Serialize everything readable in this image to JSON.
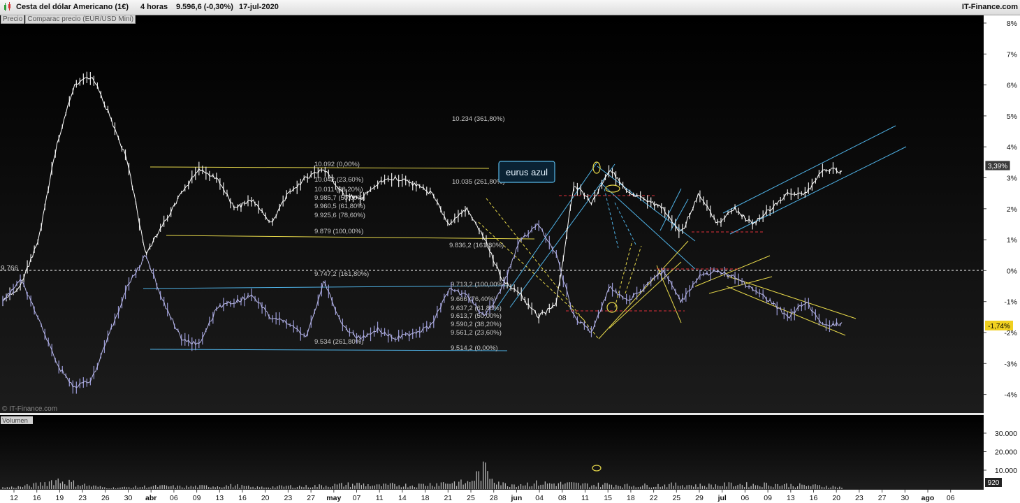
{
  "header": {
    "instrument": "Cesta del dólar Americano (1€)",
    "timeframe": "4 horas",
    "quote": "9.596,6 (-0,30%)",
    "date": "17-jul-2020",
    "brand": "IT-Finance.com"
  },
  "tabs": [
    "Precio",
    "Comparac precio (EUR/USD Mini)"
  ],
  "watermark": "© IT-Finance.com",
  "volume_label": "Volumen",
  "annotation_box": "eurus azul",
  "price_tags": {
    "usd": "3,39%",
    "eurusd": "-1,74%",
    "left_level": "9,766",
    "volume_last": "920"
  },
  "y_axis": [
    "8%",
    "7%",
    "6%",
    "5%",
    "4%",
    "3%",
    "2%",
    "1%",
    "0%",
    "-1%",
    "-2%",
    "-3%",
    "-4%"
  ],
  "volume_axis": [
    "30.000",
    "20.000",
    "10.000"
  ],
  "x_axis": [
    "12",
    "16",
    "19",
    "23",
    "26",
    "30",
    "abr",
    "06",
    "09",
    "13",
    "16",
    "20",
    "23",
    "27",
    "may",
    "07",
    "11",
    "14",
    "18",
    "21",
    "25",
    "28",
    "jun",
    "04",
    "08",
    "11",
    "15",
    "18",
    "22",
    "25",
    "29",
    "jul",
    "06",
    "09",
    "13",
    "16",
    "20",
    "23",
    "27",
    "30",
    "ago",
    "06"
  ],
  "fib_upper": [
    "10.234 (361,80%)",
    "10.092 (0,00%)",
    "10.042 (23,60%)",
    "10.035 (261,80%)",
    "10.011 (38,20%)",
    "9.985,7 (50,00%)",
    "9.960,5 (61,80%)",
    "9.925,6 (78,60%)",
    "9.879 (100,00%)",
    "9.836,2 (161,80%)"
  ],
  "fib_lower": [
    "9.747,2 (161,80%)",
    "9.713,2 (100,00%)",
    "9.666 (76,40%)",
    "9.637,2 (61,80%)",
    "9.613,7 (50,00%)",
    "9.590,2 (38,20%)",
    "9.561,2 (23,60%)",
    "9.534 (261,80%)",
    "9.514,2 (0,00%)"
  ],
  "chart_data": {
    "type": "line",
    "title": "Cesta del dólar Americano (1€)",
    "ylabel": "",
    "xlabel": "",
    "ylim": [
      -4.5,
      8.2
    ],
    "grid": false,
    "series": [
      {
        "name": "Cesta del dólar Americano (1€)",
        "color": "#ffffff",
        "values": [
          -1.0,
          -0.5,
          1.0,
          4.0,
          6.0,
          6.3,
          5.0,
          3.5,
          0.5,
          1.5,
          2.5,
          3.3,
          3.0,
          2.0,
          2.3,
          1.5,
          2.5,
          3.0,
          3.3,
          2.5,
          2.3,
          2.8,
          3.0,
          2.8,
          2.5,
          1.5,
          2.0,
          1.0,
          -0.3,
          -0.8,
          -1.5,
          -1.1,
          2.8,
          2.2,
          3.3,
          2.5,
          2.3,
          2.0,
          1.2,
          2.5,
          1.5,
          2.0,
          1.5,
          2.0,
          2.5,
          2.5,
          3.3,
          3.2
        ]
      },
      {
        "name": "Comparac precio (EUR/USD Mini)",
        "color": "#8a8ad0",
        "values": [
          -1.0,
          -0.3,
          -1.5,
          -3.0,
          -3.8,
          -3.5,
          -2.0,
          -0.5,
          0.5,
          -1.0,
          -2.2,
          -2.4,
          -1.2,
          -1.0,
          -0.8,
          -1.5,
          -1.7,
          -2.2,
          -0.3,
          -1.8,
          -2.2,
          -1.9,
          -2.2,
          -2.0,
          -1.8,
          -0.6,
          -0.8,
          -1.5,
          -0.5,
          1.0,
          1.5,
          0.5,
          -1.5,
          -2.0,
          -0.5,
          -1.0,
          -0.5,
          0.0,
          -1.0,
          -0.2,
          0.0,
          -0.2,
          -0.6,
          -1.0,
          -1.5,
          -1.0,
          -1.8,
          -1.7
        ]
      }
    ],
    "volume": [
      800,
      1200,
      2400,
      4800,
      3000,
      1500,
      600,
      900,
      1300,
      1500,
      1200,
      1400,
      1600,
      1800,
      900,
      1100,
      1500,
      1400,
      1800,
      2200,
      2600,
      1700,
      2200,
      1900,
      2600,
      3500,
      3000,
      10000,
      2500,
      2600,
      3000,
      2800,
      2600,
      2100,
      2500,
      1800,
      1900,
      2100,
      2300,
      1900,
      2000,
      2500,
      2200,
      2500,
      2100,
      1800,
      1600,
      920
    ],
    "annotations": [
      "eurus azul"
    ]
  }
}
